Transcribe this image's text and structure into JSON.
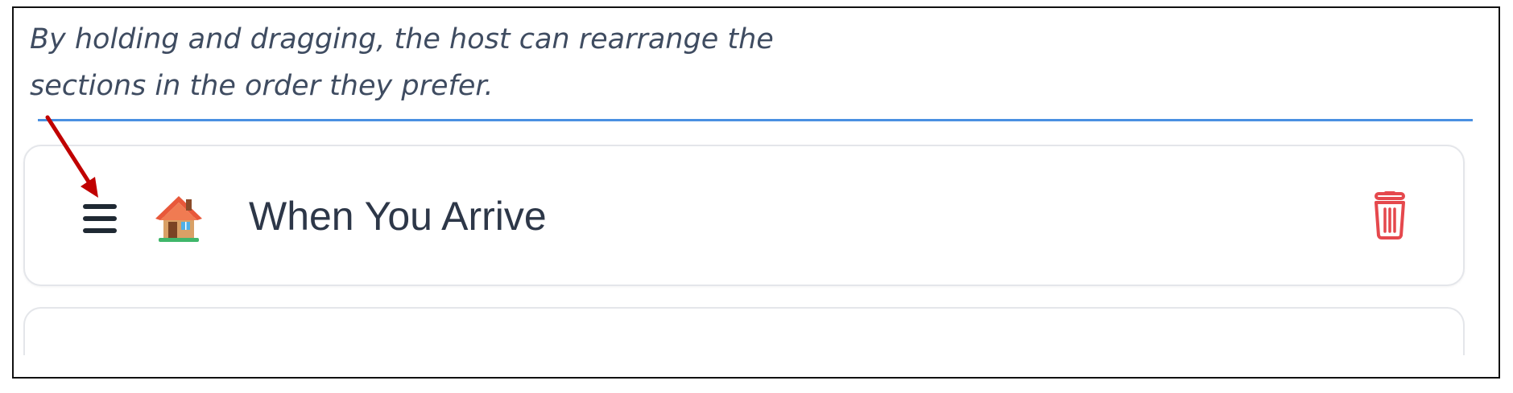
{
  "caption": {
    "line1": "By holding and dragging, the host can rearrange the",
    "line2": "sections in the order they prefer."
  },
  "section": {
    "title": "When You Arrive",
    "icon": "house-icon",
    "drag_icon": "drag-handle-icon",
    "delete_icon": "trash-icon"
  },
  "colors": {
    "divider": "#4a90e2",
    "arrow": "#c00000",
    "delete": "#e5484d",
    "title_text": "#2d3748",
    "caption_text": "#3f4c61"
  }
}
